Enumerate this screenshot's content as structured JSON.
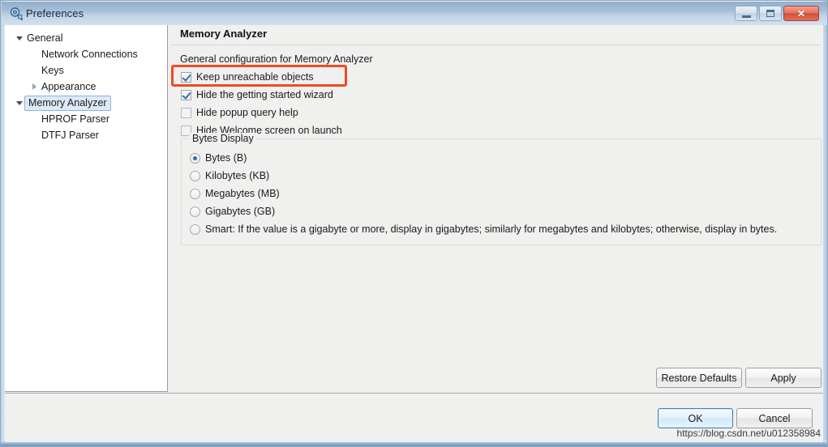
{
  "window": {
    "title": "Preferences",
    "icon": "preferences-search-icon",
    "controls": {
      "minimize": "minimize-icon",
      "maximize": "maximize-icon",
      "close": "✕"
    }
  },
  "sidebar": {
    "items": [
      {
        "label": "General",
        "level": 0,
        "twisty": "expanded",
        "selected": false
      },
      {
        "label": "Network Connections",
        "level": 1,
        "twisty": "none",
        "selected": false
      },
      {
        "label": "Keys",
        "level": 1,
        "twisty": "none",
        "selected": false
      },
      {
        "label": "Appearance",
        "level": 1,
        "twisty": "collapsed",
        "selected": false
      },
      {
        "label": "Memory Analyzer",
        "level": 0,
        "twisty": "expanded",
        "selected": true
      },
      {
        "label": "HPROF Parser",
        "level": 1,
        "twisty": "none",
        "selected": false
      },
      {
        "label": "DTFJ Parser",
        "level": 1,
        "twisty": "none",
        "selected": false
      }
    ]
  },
  "page": {
    "title": "Memory Analyzer",
    "description": "General configuration for Memory Analyzer",
    "checkboxes": [
      {
        "label": "Keep unreachable objects",
        "checked": true,
        "highlighted": true
      },
      {
        "label": "Hide the getting started wizard",
        "checked": true,
        "highlighted": false
      },
      {
        "label": "Hide popup query help",
        "checked": false,
        "highlighted": false
      },
      {
        "label": "Hide Welcome screen on launch",
        "checked": false,
        "highlighted": false
      }
    ],
    "bytes_display": {
      "group_title": "Bytes Display",
      "options": [
        {
          "label": "Bytes (B)",
          "selected": true
        },
        {
          "label": "Kilobytes (KB)",
          "selected": false
        },
        {
          "label": "Megabytes (MB)",
          "selected": false
        },
        {
          "label": "Gigabytes (GB)",
          "selected": false
        },
        {
          "label": "Smart: If the value is a gigabyte or more, display in gigabytes; similarly for megabytes and kilobytes; otherwise, display in bytes.",
          "selected": false
        }
      ]
    }
  },
  "buttons": {
    "restore_defaults": "Restore Defaults",
    "apply": "Apply",
    "ok": "OK",
    "cancel": "Cancel"
  },
  "watermark": "https://blog.csdn.net/u012358984",
  "colors": {
    "annotation": "#f04a22",
    "accent": "#3b6ea5",
    "titlebar_top": "#92aecb",
    "titlebar_bottom": "#d3e0ee"
  }
}
